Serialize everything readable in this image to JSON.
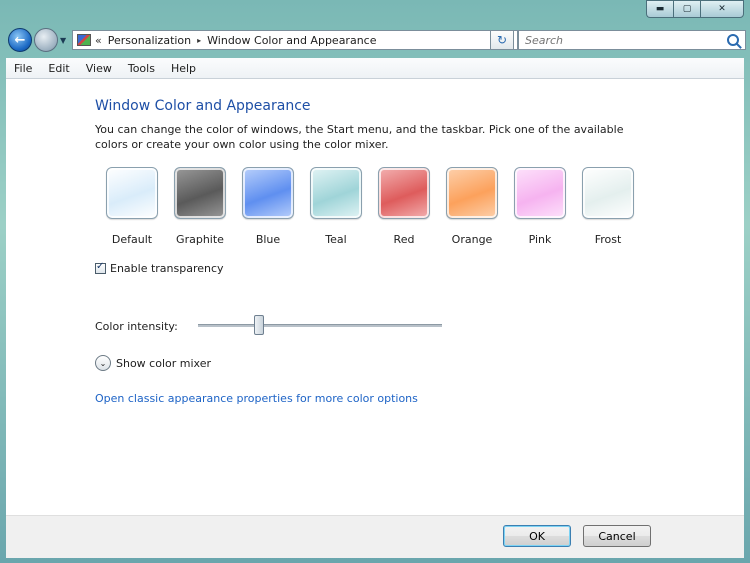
{
  "window": {
    "controls": {
      "minimize": "▬",
      "maximize": "▢",
      "close": "✕"
    }
  },
  "nav": {
    "back_icon": "←",
    "breadcrumb_prefix": "«",
    "breadcrumbs": [
      "Personalization",
      "Window Color and Appearance"
    ],
    "breadcrumb_separator": "▸",
    "dropdown_arrow": "▼",
    "refresh_icon": "↻",
    "search_placeholder": "Search"
  },
  "menu": {
    "items": [
      "File",
      "Edit",
      "View",
      "Tools",
      "Help"
    ]
  },
  "main": {
    "title": "Window Color and Appearance",
    "description": "You can change the color of windows, the Start menu, and the taskbar. Pick one of the available colors or create your own color using the color mixer.",
    "swatches": [
      {
        "label": "Default",
        "color": "#d9ecfa",
        "color2": "#ffffff"
      },
      {
        "label": "Graphite",
        "color": "#5a5a5a",
        "color2": "#9a9a9a"
      },
      {
        "label": "Blue",
        "color": "#5f8ff0",
        "color2": "#b9d0fb"
      },
      {
        "label": "Teal",
        "color": "#9fd4d8",
        "color2": "#e2f4f5"
      },
      {
        "label": "Red",
        "color": "#de5c5c",
        "color2": "#f3b1b1"
      },
      {
        "label": "Orange",
        "color": "#fca15c",
        "color2": "#fdd1ad"
      },
      {
        "label": "Pink",
        "color": "#f6b3f0",
        "color2": "#fde2fb"
      },
      {
        "label": "Frost",
        "color": "#e4efee",
        "color2": "#ffffff"
      }
    ],
    "transparency": {
      "label": "Enable transparency",
      "checked": true
    },
    "intensity": {
      "label": "Color intensity:",
      "value_fraction": 0.24
    },
    "mixer": {
      "label": "Show color mixer",
      "expander_icon": "⌄"
    },
    "link": "Open classic appearance properties for more color options"
  },
  "buttons": {
    "ok": "OK",
    "cancel": "Cancel"
  }
}
